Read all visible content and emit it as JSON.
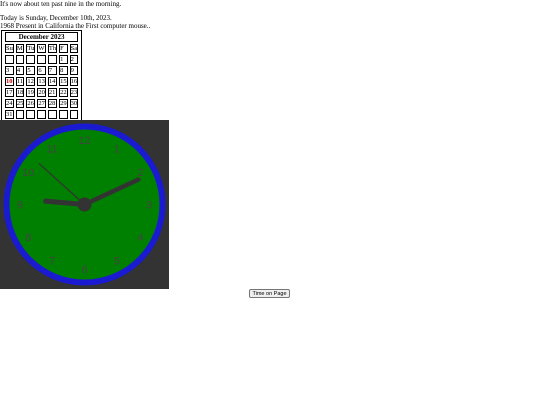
{
  "greeting": "It's now about ten past nine in the morning.",
  "today_text": "Today is Sunday, December 10th, 2023.",
  "history_text": "1968 Present in California the First computer mouse..",
  "calendar": {
    "title": "December 2023",
    "weekdays": [
      "Su",
      "M",
      "Tu",
      "W",
      "Th",
      "F",
      "Sa"
    ],
    "weeks": [
      [
        "",
        "",
        "",
        "",
        "",
        "1",
        "2"
      ],
      [
        "3",
        "4",
        "5",
        "6",
        "7",
        "8",
        "9"
      ],
      [
        "10",
        "11",
        "12",
        "13",
        "14",
        "15",
        "16"
      ],
      [
        "17",
        "18",
        "19",
        "20",
        "21",
        "22",
        "23"
      ],
      [
        "24",
        "25",
        "26",
        "27",
        "28",
        "29",
        "30"
      ],
      [
        "31",
        "",
        "",
        "",
        "",
        "",
        ""
      ]
    ],
    "highlighted_day": "10",
    "highlight_color": "#cc0000"
  },
  "clock": {
    "numbers": [
      "12",
      "1",
      "2",
      "3",
      "4",
      "5",
      "6",
      "7",
      "8",
      "9",
      "10",
      "11"
    ],
    "time": {
      "hour": 9,
      "minute": 10,
      "second": 52
    },
    "face_color": "#008000",
    "rim_color": "#1a1ad1",
    "background_color": "#333333",
    "hand_color": "#333333"
  },
  "time_button_label": "Time on Page"
}
